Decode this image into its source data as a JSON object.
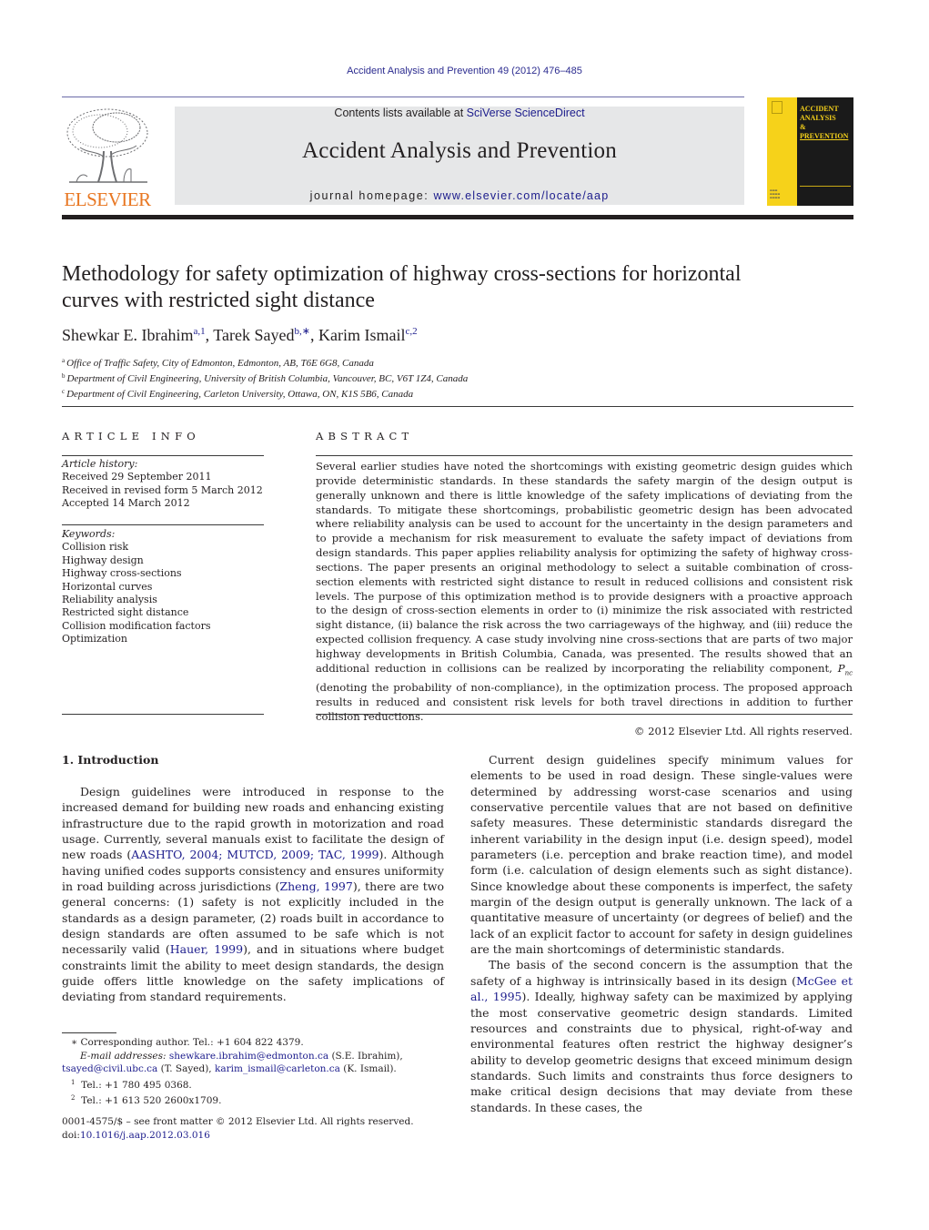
{
  "journal_header": {
    "running_head": "Accident Analysis and Prevention 49 (2012) 476–485",
    "contents_prefix": "Contents lists available at ",
    "contents_link": "SciVerse ScienceDirect",
    "journal_title": "Accident Analysis and Prevention",
    "homepage_prefix": "journal homepage: ",
    "homepage_link": "www.elsevier.com/locate/aap",
    "publisher_logo_text": "ELSEVIER",
    "cover_title_lines": [
      "ACCIDENT",
      "ANALYSIS",
      "&",
      "PREVENTION"
    ],
    "colors": {
      "link": "#1c1c8c",
      "elsevier_orange": "#e87722",
      "cover_yellow": "#f6d21a",
      "banner_grey": "#e6e7e8"
    }
  },
  "article": {
    "title_line1": "Methodology for safety optimization of highway cross-sections for horizontal",
    "title_line2": "curves with restricted sight distance",
    "authors": [
      {
        "name": "Shewkar E. Ibrahim",
        "marks": "a,1",
        "sep": ", "
      },
      {
        "name": "Tarek Sayed",
        "marks": "b,∗",
        "sep": ", "
      },
      {
        "name": "Karim Ismail",
        "marks": "c,2",
        "sep": ""
      }
    ],
    "affiliations": [
      {
        "mark": "a",
        "text": "Office of Traffic Safety, City of Edmonton, Edmonton, AB, T6E 6G8, Canada"
      },
      {
        "mark": "b",
        "text": "Department of Civil Engineering, University of British Columbia, Vancouver, BC, V6T 1Z4, Canada"
      },
      {
        "mark": "c",
        "text": "Department of Civil Engineering, Carleton University, Ottawa, ON, K1S 5B6, Canada"
      }
    ]
  },
  "article_info": {
    "heading": "ARTICLE INFO",
    "history_label": "Article history:",
    "history": [
      "Received 29 September 2011",
      "Received in revised form 5 March 2012",
      "Accepted 14 March 2012"
    ],
    "keywords_label": "Keywords:",
    "keywords": [
      "Collision risk",
      "Highway design",
      "Highway cross-sections",
      "Horizontal curves",
      "Reliability analysis",
      "Restricted sight distance",
      "Collision modification factors",
      "Optimization"
    ]
  },
  "abstract": {
    "heading": "ABSTRACT",
    "text_part1": "Several earlier studies have noted the shortcomings with existing geometric design guides which provide deterministic standards. In these standards the safety margin of the design output is generally unknown and there is little knowledge of the safety implications of deviating from the standards. To mitigate these shortcomings, probabilistic geometric design has been advocated where reliability analysis can be used to account for the uncertainty in the design parameters and to provide a mechanism for risk measurement to evaluate the safety impact of deviations from design standards. This paper applies reliability analysis for optimizing the safety of highway cross-sections. The paper presents an original methodology to select a suitable combination of cross-section elements with restricted sight distance to result in reduced collisions and consistent risk levels. The purpose of this optimization method is to provide designers with a proactive approach to the design of cross-section elements in order to (i) minimize the risk associated with restricted sight distance, (ii) balance the risk across the two carriageways of the highway, and (iii) reduce the expected collision frequency. A case study involving nine cross-sections that are parts of two major highway developments in British Columbia, Canada, was presented. The results showed that an additional reduction in collisions can be realized by incorporating the reliability component, ",
    "symbol_main": "P",
    "symbol_sub": "nc",
    "text_part2": " (denoting the probability of non-compliance), in the optimization process. The proposed approach results in reduced and consistent risk levels for both travel directions in addition to further collision reductions.",
    "copyright": "© 2012 Elsevier Ltd. All rights reserved."
  },
  "body": {
    "section_heading": "1.  Introduction",
    "left_p1": [
      {
        "t": "Design guidelines were introduced in response to the increased demand for building new roads and enhancing existing infrastructure due to the rapid growth in motorization and road usage. Currently, several manuals exist to facilitate the design of new roads ("
      },
      {
        "link": "AASHTO, 2004; MUTCD, 2009; TAC, 1999"
      },
      {
        "t": "). Although having unified codes supports consistency and ensures uniformity in road building across jurisdictions ("
      },
      {
        "link": "Zheng, 1997"
      },
      {
        "t": "), there are two general concerns: (1) safety is not explicitly included in the standards as a design parameter, (2) roads built in accordance to design standards are often assumed to be safe which is not necessarily valid ("
      },
      {
        "link": "Hauer, 1999"
      },
      {
        "t": "), and in situations where budget constraints limit the ability to meet design standards, the design guide offers little knowledge on the safety implications of deviating from standard requirements."
      }
    ],
    "right_p1": "Current design guidelines specify minimum values for elements to be used in road design. These single-values were determined by addressing worst-case scenarios and using conservative percentile values that are not based on definitive safety measures. These deterministic standards disregard the inherent variability in the design input (i.e. design speed), model parameters (i.e. perception and brake reaction time), and model form (i.e. calculation of design elements such as sight distance). Since knowledge about these components is imperfect, the safety margin of the design output is generally unknown. The lack of a quantitative measure of uncertainty (or degrees of belief) and the lack of an explicit factor to account for safety in design guidelines are the main shortcomings of deterministic standards.",
    "right_p2": [
      {
        "t": "The basis of the second concern is the assumption that the safety of a highway is intrinsically based in its design ("
      },
      {
        "link": "McGee et al., 1995"
      },
      {
        "t": "). Ideally, highway safety can be maximized by applying the most conservative geometric design standards. Limited resources and constraints due to physical, right-of-way and environmental features often restrict the highway designer’s ability to develop geometric designs that exceed minimum design standards. Such limits and constraints thus force designers to make critical design decisions that may deviate from these standards. In these cases, the"
      }
    ]
  },
  "footnotes": {
    "corresponding": "∗  Corresponding author. Tel.: +1 604 822 4379.",
    "email_label": "E-mail addresses: ",
    "emails": [
      {
        "addr": "shewkare.ibrahim@edmonton.ca",
        "who": " (S.E. Ibrahim),"
      },
      {
        "addr": "tsayed@civil.ubc.ca",
        "who": " (T. Sayed), "
      },
      {
        "addr": "karim_ismail@carleton.ca",
        "who": " (K. Ismail)."
      }
    ],
    "fn1_mark": "1",
    "fn1": "Tel.: +1 780 495 0368.",
    "fn2_mark": "2",
    "fn2": "Tel.: +1 613 520 2600x1709.",
    "issn_line": "0001-4575/$ – see front matter © 2012 Elsevier Ltd. All rights reserved.",
    "doi_prefix": "doi:",
    "doi": "10.1016/j.aap.2012.03.016"
  }
}
